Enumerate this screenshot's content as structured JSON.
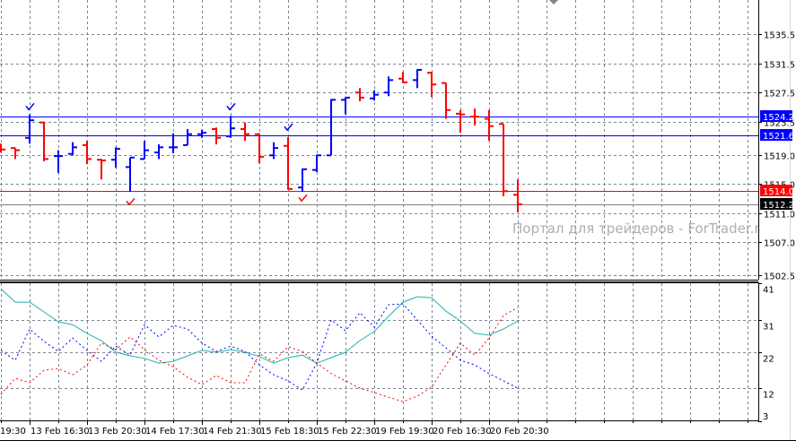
{
  "watermark": "Портал для трейдеров - ForTrader.ru",
  "colors": {
    "up": "#0000ff",
    "down": "#ff0000",
    "grid": "#7b8794",
    "teal": "#20b2aa",
    "background": "#ffffff"
  },
  "chart_data": [
    {
      "type": "ohlc",
      "ylim": [
        1502.5,
        1535.5
      ],
      "y_ticks": [
        "1535.5",
        "1531.5",
        "1527.5",
        "1523.5",
        "1519.0",
        "1515.0",
        "1511.0",
        "1507.0",
        "1502.5"
      ],
      "x_ticks": [
        "19:30",
        "13 Feb 16:30",
        "13 Feb 20:30",
        "14 Feb 17:30",
        "14 Feb 21:30",
        "15 Feb 18:30",
        "15 Feb 22:30",
        "19 Feb 19:30",
        "20 Feb 16:30",
        "20 Feb 20:30"
      ],
      "grid": true,
      "bars": [
        {
          "o": 1520.0,
          "h": 1520.5,
          "l": 1519.3,
          "c": 1519.7,
          "dir": "down"
        },
        {
          "o": 1519.9,
          "h": 1519.9,
          "l": 1518.4,
          "c": 1519.6,
          "dir": "down"
        },
        {
          "o": 1521.3,
          "h": 1524.5,
          "l": 1520.5,
          "c": 1523.7,
          "dir": "up"
        },
        {
          "o": 1523.4,
          "h": 1523.5,
          "l": 1518.1,
          "c": 1518.4,
          "dir": "down"
        },
        {
          "o": 1518.8,
          "h": 1519.6,
          "l": 1516.5,
          "c": 1518.8,
          "dir": "up"
        },
        {
          "o": 1519.1,
          "h": 1520.7,
          "l": 1518.9,
          "c": 1520.0,
          "dir": "up"
        },
        {
          "o": 1520.3,
          "h": 1520.9,
          "l": 1517.7,
          "c": 1518.4,
          "dir": "down"
        },
        {
          "o": 1518.3,
          "h": 1518.4,
          "l": 1515.6,
          "c": 1518.2,
          "dir": "down"
        },
        {
          "o": 1518.3,
          "h": 1520.0,
          "l": 1517.2,
          "c": 1519.8,
          "dir": "up"
        },
        {
          "o": 1517.3,
          "h": 1518.6,
          "l": 1513.9,
          "c": 1518.6,
          "dir": "up"
        },
        {
          "o": 1518.4,
          "h": 1520.9,
          "l": 1518.4,
          "c": 1519.6,
          "dir": "up"
        },
        {
          "o": 1519.3,
          "h": 1520.4,
          "l": 1518.4,
          "c": 1520.0,
          "dir": "up"
        },
        {
          "o": 1520.0,
          "h": 1521.9,
          "l": 1519.2,
          "c": 1520.0,
          "dir": "up"
        },
        {
          "o": 1520.3,
          "h": 1522.5,
          "l": 1520.3,
          "c": 1521.8,
          "dir": "up"
        },
        {
          "o": 1521.8,
          "h": 1522.4,
          "l": 1521.3,
          "c": 1522.0,
          "dir": "up"
        },
        {
          "o": 1522.5,
          "h": 1522.7,
          "l": 1520.4,
          "c": 1521.3,
          "dir": "down"
        },
        {
          "o": 1521.5,
          "h": 1524.3,
          "l": 1521.3,
          "c": 1522.6,
          "dir": "up"
        },
        {
          "o": 1522.5,
          "h": 1523.4,
          "l": 1520.9,
          "c": 1521.8,
          "dir": "down"
        },
        {
          "o": 1521.8,
          "h": 1521.9,
          "l": 1517.8,
          "c": 1518.7,
          "dir": "down"
        },
        {
          "o": 1518.9,
          "h": 1520.7,
          "l": 1518.4,
          "c": 1519.9,
          "dir": "up"
        },
        {
          "o": 1520.2,
          "h": 1521.4,
          "l": 1514.2,
          "c": 1514.3,
          "dir": "down"
        },
        {
          "o": 1514.5,
          "h": 1517.1,
          "l": 1513.9,
          "c": 1517.0,
          "dir": "up"
        },
        {
          "o": 1516.9,
          "h": 1519.0,
          "l": 1516.6,
          "c": 1518.9,
          "dir": "up"
        },
        {
          "o": 1518.9,
          "h": 1526.6,
          "l": 1518.9,
          "c": 1526.5,
          "dir": "up"
        },
        {
          "o": 1526.5,
          "h": 1526.9,
          "l": 1524.5,
          "c": 1526.8,
          "dir": "up"
        },
        {
          "o": 1527.5,
          "h": 1528.1,
          "l": 1526.3,
          "c": 1526.8,
          "dir": "down"
        },
        {
          "o": 1526.7,
          "h": 1527.8,
          "l": 1526.4,
          "c": 1527.2,
          "dir": "up"
        },
        {
          "o": 1527.5,
          "h": 1529.7,
          "l": 1527.0,
          "c": 1529.2,
          "dir": "up"
        },
        {
          "o": 1529.4,
          "h": 1530.3,
          "l": 1528.8,
          "c": 1528.9,
          "dir": "down"
        },
        {
          "o": 1529.2,
          "h": 1530.7,
          "l": 1528.1,
          "c": 1530.6,
          "dir": "up"
        },
        {
          "o": 1530.2,
          "h": 1530.3,
          "l": 1526.9,
          "c": 1528.6,
          "dir": "down"
        },
        {
          "o": 1528.8,
          "h": 1528.8,
          "l": 1523.9,
          "c": 1525.1,
          "dir": "down"
        },
        {
          "o": 1524.6,
          "h": 1525.1,
          "l": 1522.0,
          "c": 1524.5,
          "dir": "down"
        },
        {
          "o": 1524.2,
          "h": 1525.3,
          "l": 1523.0,
          "c": 1524.2,
          "dir": "down"
        },
        {
          "o": 1523.9,
          "h": 1525.1,
          "l": 1520.9,
          "c": 1522.9,
          "dir": "down"
        },
        {
          "o": 1523.2,
          "h": 1523.2,
          "l": 1513.3,
          "c": 1514.0,
          "dir": "down"
        },
        {
          "o": 1513.5,
          "h": 1515.6,
          "l": 1511.1,
          "c": 1512.2,
          "dir": "down"
        }
      ],
      "signals": [
        {
          "bar": 3,
          "type": "buy",
          "price": 1525.4
        },
        {
          "bar": 17,
          "type": "buy",
          "price": 1525.4
        },
        {
          "bar": 21,
          "type": "buy",
          "price": 1522.6
        },
        {
          "bar": 10,
          "type": "sell",
          "price": 1512.4
        },
        {
          "bar": 22,
          "type": "sell",
          "price": 1512.9
        }
      ],
      "levels": [
        {
          "price": "1524.2",
          "color": "#0000ff",
          "label_bg": "#0000ff"
        },
        {
          "price": "1521.6",
          "color": "#0000ff",
          "label_bg": "#0000ff"
        },
        {
          "price": "1514.0",
          "color": "#ff0000",
          "label_bg": "#ff0000"
        },
        {
          "price": "1512.2",
          "color": "#808080",
          "label_bg": "#000000"
        }
      ]
    },
    {
      "type": "line",
      "ylim": [
        3,
        41
      ],
      "y_ticks": [
        "41",
        "31",
        "22",
        "12",
        "3"
      ],
      "grid": true,
      "series": [
        {
          "color": "#20b2aa",
          "style": "solid",
          "values": [
            39.5,
            35.8,
            35.8,
            33.1,
            30.4,
            29.6,
            27.2,
            25.2,
            22.0,
            21.0,
            20.3,
            19.0,
            19.5,
            21.0,
            22.5,
            22.0,
            22.7,
            22.0,
            20.8,
            19.0,
            20.5,
            21.2,
            19.0,
            20.5,
            22.0,
            25.2,
            27.7,
            31.9,
            35.8,
            37.3,
            37.0,
            33.3,
            30.6,
            27.2,
            26.7,
            28.4,
            30.6
          ]
        },
        {
          "color": "#0000ff",
          "style": "dotted",
          "values": [
            22.5,
            19.8,
            28.4,
            25.0,
            22.2,
            25.9,
            22.5,
            19.5,
            23.7,
            21.2,
            29.6,
            26.2,
            29.4,
            28.4,
            24.5,
            22.2,
            23.7,
            22.2,
            18.5,
            15.8,
            14.1,
            11.6,
            19.0,
            30.9,
            27.9,
            32.9,
            28.9,
            35.1,
            35.3,
            30.9,
            26.4,
            23.2,
            19.8,
            18.5,
            16.1,
            14.1,
            12.1
          ]
        },
        {
          "color": "#ff0000",
          "style": "dotted",
          "values": [
            10.4,
            14.8,
            13.6,
            17.0,
            17.5,
            15.8,
            18.5,
            24.5,
            22.7,
            26.2,
            22.7,
            19.8,
            18.0,
            15.1,
            13.1,
            15.6,
            13.6,
            13.6,
            21.5,
            19.5,
            23.5,
            22.2,
            19.0,
            16.1,
            14.1,
            12.1,
            10.9,
            9.6,
            8.4,
            9.9,
            12.4,
            18.5,
            24.5,
            21.2,
            25.9,
            32.1,
            34.3
          ]
        }
      ]
    }
  ]
}
